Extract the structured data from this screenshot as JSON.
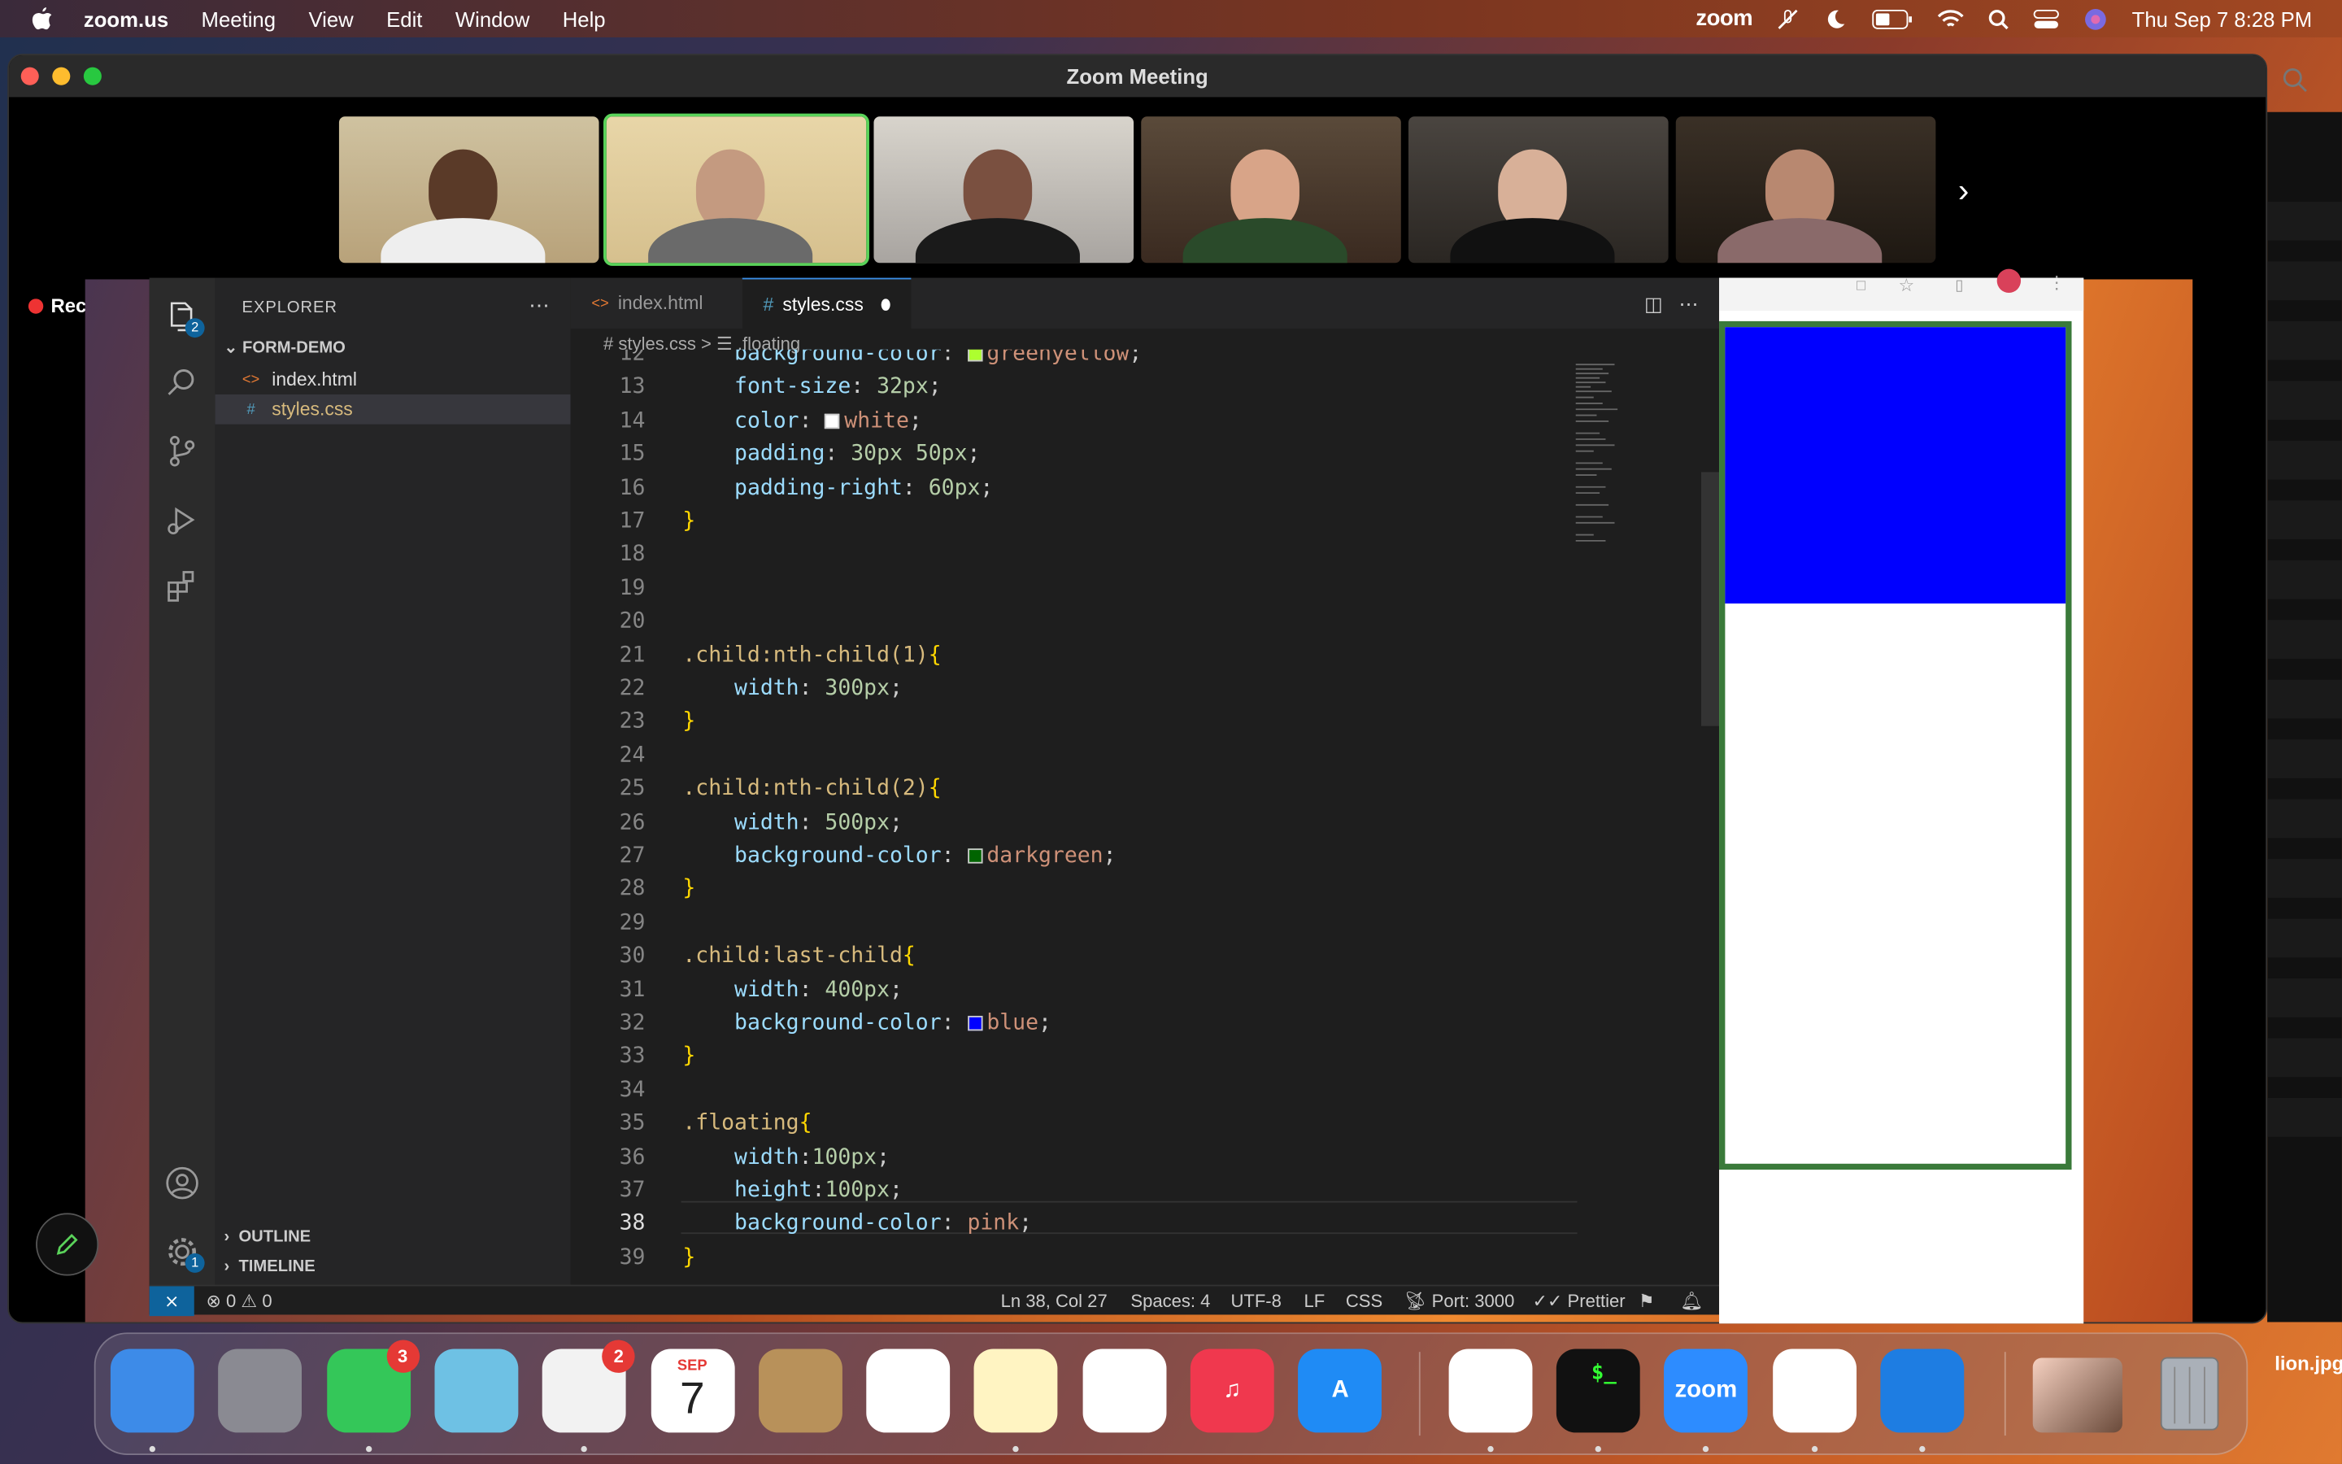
{
  "menubar": {
    "app": "zoom.us",
    "items": [
      "Meeting",
      "View",
      "Edit",
      "Window",
      "Help"
    ],
    "zoom_label": "zoom",
    "clock": "Thu Sep 7  8:28 PM"
  },
  "zoom": {
    "title": "Zoom Meeting",
    "recording_label": "Recording"
  },
  "vscode": {
    "explorer_header": "EXPLORER",
    "folder": "FORM-DEMO",
    "files": [
      {
        "name": "index.html",
        "icon": "<>"
      },
      {
        "name": "styles.css",
        "icon": "#"
      }
    ],
    "outline": "OUTLINE",
    "timeline": "TIMELINE",
    "explorer_badge": "2",
    "settings_badge": "1",
    "tabs": [
      {
        "label": "index.html",
        "icon": "<>"
      },
      {
        "label": "styles.css",
        "icon": "#"
      }
    ],
    "breadcrumb": "# styles.css  >  ☰ .floating",
    "code": [
      {
        "n": "12",
        "t": "    background-color: greenyellow;"
      },
      {
        "n": "13",
        "t": "    font-size: 32px;"
      },
      {
        "n": "14",
        "t": "    color: white;"
      },
      {
        "n": "15",
        "t": "    padding: 30px 50px;"
      },
      {
        "n": "16",
        "t": "    padding-right: 60px;"
      },
      {
        "n": "17",
        "t": "}"
      },
      {
        "n": "18",
        "t": ""
      },
      {
        "n": "19",
        "t": ""
      },
      {
        "n": "20",
        "t": ""
      },
      {
        "n": "21",
        "t": ".child:nth-child(1){"
      },
      {
        "n": "22",
        "t": "    width: 300px;"
      },
      {
        "n": "23",
        "t": "}"
      },
      {
        "n": "24",
        "t": ""
      },
      {
        "n": "25",
        "t": ".child:nth-child(2){"
      },
      {
        "n": "26",
        "t": "    width: 500px;"
      },
      {
        "n": "27",
        "t": "    background-color: darkgreen;"
      },
      {
        "n": "28",
        "t": "}"
      },
      {
        "n": "29",
        "t": ""
      },
      {
        "n": "30",
        "t": ".child:last-child{"
      },
      {
        "n": "31",
        "t": "    width: 400px;"
      },
      {
        "n": "32",
        "t": "    background-color: blue;"
      },
      {
        "n": "33",
        "t": "}"
      },
      {
        "n": "34",
        "t": ""
      },
      {
        "n": "35",
        "t": ".floating{"
      },
      {
        "n": "36",
        "t": "    width:100px;"
      },
      {
        "n": "37",
        "t": "    height:100px;"
      },
      {
        "n": "38",
        "t": "    background-color: pink;"
      },
      {
        "n": "39",
        "t": "}"
      }
    ],
    "current_line": "38",
    "status": {
      "problems": "⊗ 0 ⚠ 0",
      "position": "Ln 38, Col 27",
      "spaces": "Spaces: 4",
      "encoding": "UTF-8",
      "eol": "LF",
      "lang": "CSS",
      "port": "Port: 3000",
      "prettier": "Prettier"
    }
  },
  "colors": {
    "swatch_greenyellow": "#adff2f",
    "swatch_white": "#ffffff",
    "swatch_darkgreen": "#006400",
    "swatch_blue": "#0000ff",
    "browser_blue": "#0000ff",
    "browser_green_border": "#3a7a3a"
  },
  "dock": {
    "items": [
      {
        "name": "finder",
        "bg": "#3d8be8",
        "label": ""
      },
      {
        "name": "launchpad",
        "bg": "#8a8a92",
        "label": ""
      },
      {
        "name": "messages",
        "bg": "#34c759",
        "label": "",
        "badge": "3"
      },
      {
        "name": "maps",
        "bg": "#6ec1e4",
        "label": ""
      },
      {
        "name": "photos",
        "bg": "#f2f2f2",
        "label": "",
        "badge": "2"
      },
      {
        "name": "calendar",
        "bg": "#ffffff",
        "label": "7",
        "month": "SEP"
      },
      {
        "name": "contacts",
        "bg": "#b8915a",
        "label": ""
      },
      {
        "name": "reminders",
        "bg": "#ffffff",
        "label": ""
      },
      {
        "name": "notes",
        "bg": "#fff4c2",
        "label": ""
      },
      {
        "name": "freeform",
        "bg": "#ffffff",
        "label": ""
      },
      {
        "name": "music",
        "bg": "#f0384e",
        "label": "♫"
      },
      {
        "name": "app-store",
        "bg": "#1f8bf5",
        "label": "A"
      },
      {
        "name": "chrome",
        "bg": "#ffffff",
        "label": ""
      },
      {
        "name": "terminal",
        "bg": "#111111",
        "label": "$_"
      },
      {
        "name": "zoom",
        "bg": "#2d8cff",
        "label": "zoom"
      },
      {
        "name": "vscode",
        "bg": "#ffffff",
        "label": ""
      },
      {
        "name": "safari",
        "bg": "#1e7de2",
        "label": ""
      }
    ],
    "file_label": "lion.jpg"
  }
}
